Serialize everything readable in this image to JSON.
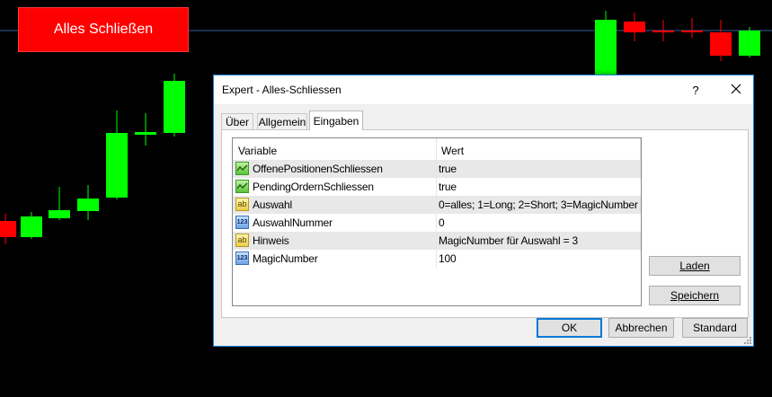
{
  "chart": {
    "h_line_color": "#3a5a9a",
    "bull_color": "#00ff00",
    "bear_color": "#ff0000"
  },
  "overlay_button": {
    "label": "Alles Schließen",
    "color": "#ff0000"
  },
  "dialog": {
    "title": "Expert - Alles-Schliessen",
    "help_label": "?",
    "tabs": [
      {
        "label": "Über"
      },
      {
        "label": "Allgemein"
      },
      {
        "label": "Eingaben"
      }
    ],
    "active_tab": "Eingaben",
    "table": {
      "headers": {
        "variable": "Variable",
        "value": "Wert"
      },
      "rows": [
        {
          "icon": "bool-icon",
          "name": "OffenePositionenSchliessen",
          "value": "true"
        },
        {
          "icon": "bool-icon",
          "name": "PendingOrdernSchliessen",
          "value": "true"
        },
        {
          "icon": "string-icon",
          "name": "Auswahl",
          "value": "0=alles; 1=Long; 2=Short; 3=MagicNumber"
        },
        {
          "icon": "int-icon",
          "name": "AuswahlNummer",
          "value": "0"
        },
        {
          "icon": "string-icon",
          "name": "Hinweis",
          "value": "MagicNumber für Auswahl = 3"
        },
        {
          "icon": "int-icon",
          "name": "MagicNumber",
          "value": "100"
        }
      ]
    },
    "side_buttons": {
      "load": "Laden",
      "save": "Speichern"
    },
    "footer_buttons": {
      "ok": "OK",
      "cancel": "Abbrechen",
      "default": "Standard"
    },
    "icons": {
      "str": "ab",
      "int": "123"
    }
  }
}
